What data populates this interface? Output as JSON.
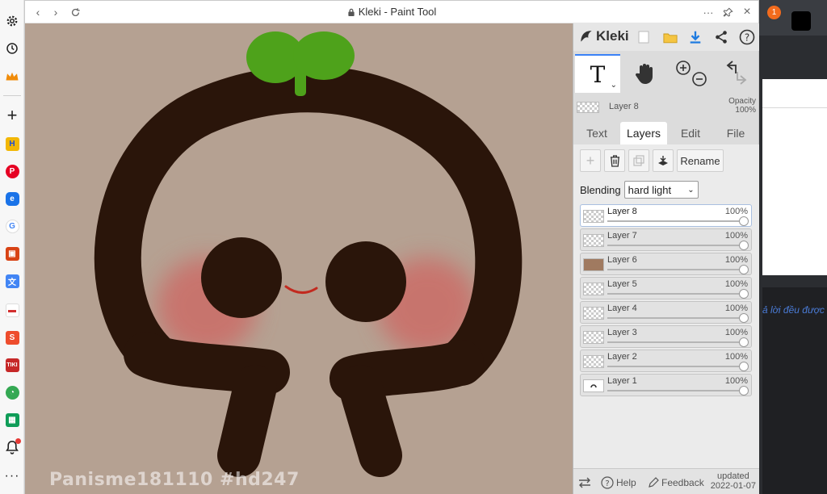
{
  "window": {
    "title": "Kleki - Paint Tool"
  },
  "canvas": {
    "watermark": "Panisme181110 #hd247",
    "background": "#b5a192"
  },
  "panel": {
    "brand": "Kleki",
    "current_layer": {
      "name": "Layer 8",
      "opacity_label": "Opacity",
      "opacity_value": "100%"
    },
    "tabs": [
      {
        "label": "Text",
        "active": false
      },
      {
        "label": "Layers",
        "active": true
      },
      {
        "label": "Edit",
        "active": false
      },
      {
        "label": "File",
        "active": false
      }
    ],
    "layer_buttons": {
      "rename": "Rename"
    },
    "blending": {
      "label": "Blending",
      "value": "hard light"
    },
    "layers": [
      {
        "name": "Layer 8",
        "opacity": "100%",
        "selected": true
      },
      {
        "name": "Layer 7",
        "opacity": "100%",
        "selected": false
      },
      {
        "name": "Layer 6",
        "opacity": "100%",
        "selected": false
      },
      {
        "name": "Layer 5",
        "opacity": "100%",
        "selected": false
      },
      {
        "name": "Layer 4",
        "opacity": "100%",
        "selected": false
      },
      {
        "name": "Layer 3",
        "opacity": "100%",
        "selected": false
      },
      {
        "name": "Layer 2",
        "opacity": "100%",
        "selected": false
      },
      {
        "name": "Layer 1",
        "opacity": "100%",
        "selected": false
      }
    ],
    "footer": {
      "help": "Help",
      "feedback": "Feedback",
      "updated_label": "updated",
      "updated_date": "2022-01-07"
    }
  },
  "background_window": {
    "badge": "1",
    "note": "ả lời đều được"
  },
  "colors": {
    "accent": "#3b82f6",
    "sprout": "#4ea21b",
    "outline": "#2a150a",
    "blush": "#c9726c"
  }
}
